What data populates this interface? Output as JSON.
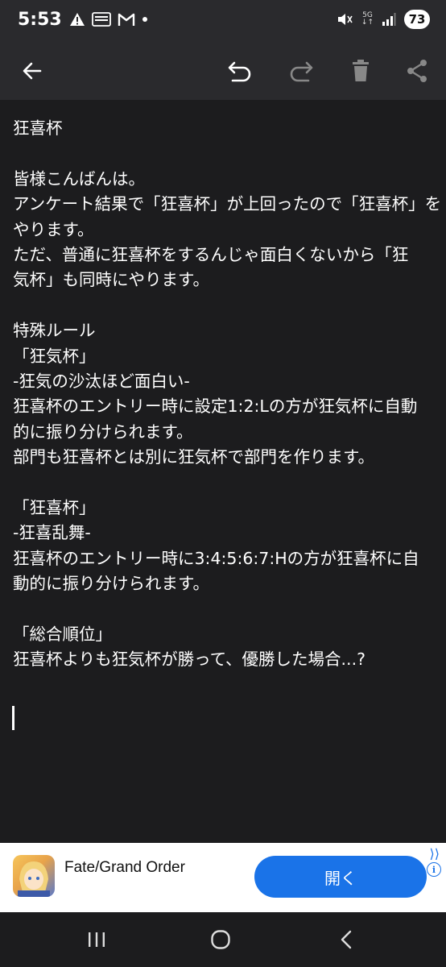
{
  "status_bar": {
    "time": "5:53",
    "network": "5G",
    "battery": "73"
  },
  "toolbar": {
    "icons": [
      "back-arrow-icon",
      "undo-icon",
      "redo-icon",
      "trash-icon",
      "share-icon"
    ]
  },
  "note": {
    "lines": [
      "狂喜杯",
      "",
      "皆様こんばんは。",
      "アンケート結果で「狂喜杯」が上回ったので「狂喜杯」を",
      "やります。",
      "ただ、普通に狂喜杯をするんじゃ面白くないから「狂",
      "気杯」も同時にやります。",
      "",
      "特殊ルール",
      "「狂気杯」",
      "-狂気の沙汰ほど面白い-",
      "狂喜杯のエントリー時に設定1:2:Lの方が狂気杯に自動",
      "的に振り分けられます。",
      "部門も狂喜杯とは別に狂気杯で部門を作ります。",
      "",
      "「狂喜杯」",
      "-狂喜乱舞-",
      "狂喜杯のエントリー時に3:4:5:6:7:Hの方が狂喜杯に自",
      "動的に振り分けられます。",
      "",
      "「総合順位」",
      "狂喜杯よりも狂気杯が勝って、優勝した場合...?"
    ]
  },
  "ad": {
    "title": "Fate/Grand Order",
    "button_label": "開く",
    "close_glyph": "⟩⟩",
    "info_glyph": "i"
  },
  "colors": {
    "background": "#1c1c1e",
    "toolbar": "#2a2a2d",
    "ad_button": "#1a73e8"
  }
}
